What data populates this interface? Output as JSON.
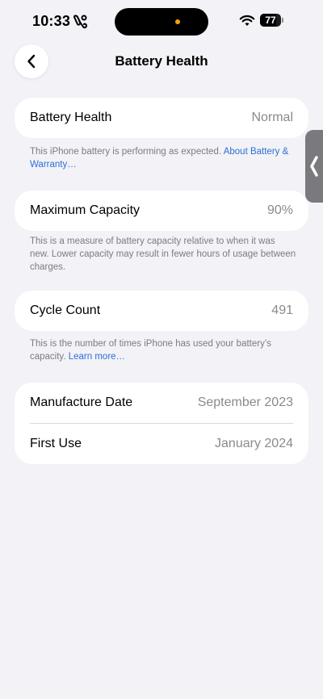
{
  "status_bar": {
    "time": "10:33",
    "battery_level": "77",
    "battery_fraction": 0.77
  },
  "nav": {
    "title": "Battery Health",
    "back_icon": "chevron-left-icon"
  },
  "battery_health": {
    "label": "Battery Health",
    "value": "Normal",
    "note": "This iPhone battery is performing as expected. ",
    "link": "About Battery & Warranty…"
  },
  "maximum_capacity": {
    "label": "Maximum Capacity",
    "value": "90%",
    "note": "This is a measure of battery capacity relative to when it was new. Lower capacity may result in fewer hours of usage between charges."
  },
  "cycle_count": {
    "label": "Cycle Count",
    "value": "491",
    "note": "This is the number of times iPhone has used your battery’s capacity. ",
    "link": "Learn more…"
  },
  "dates": {
    "manufacture_label": "Manufacture Date",
    "manufacture_value": "September 2023",
    "first_use_label": "First Use",
    "first_use_value": "January 2024"
  },
  "colors": {
    "background": "#f2f2f7",
    "link": "#2e6fd6",
    "secondary_text": "#8a8a8e",
    "island_indicator": "#ff9f0a"
  }
}
